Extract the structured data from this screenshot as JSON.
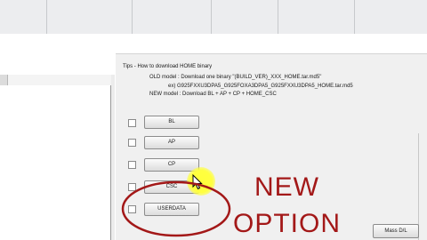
{
  "tips": {
    "heading": "Tips - How to download HOME binary",
    "old_model": "OLD model : Download one binary    \"(BUILD_VER)_XXX_HOME.tar.md5\"",
    "example": "ex) G925FXXU3DPA5_G925FOXA3DPA5_G925FXXU3DPA5_HOME.tar.md5",
    "new_model": "NEW model : Download BL + AP + CP + HOME_CSC"
  },
  "files": [
    {
      "label": "BL",
      "checked": false
    },
    {
      "label": "AP",
      "checked": false
    },
    {
      "label": "CP",
      "checked": false
    },
    {
      "label": "CSC",
      "checked": false
    },
    {
      "label": "USERDATA",
      "checked": false
    }
  ],
  "actions": {
    "mass_dl": "Mass D/L"
  },
  "overlay": {
    "line1": "NEW",
    "line2": "OPTION",
    "color": "#a31818",
    "highlight": "#ffff40"
  },
  "icons": [
    "cursor-icon",
    "checkbox-icon"
  ]
}
